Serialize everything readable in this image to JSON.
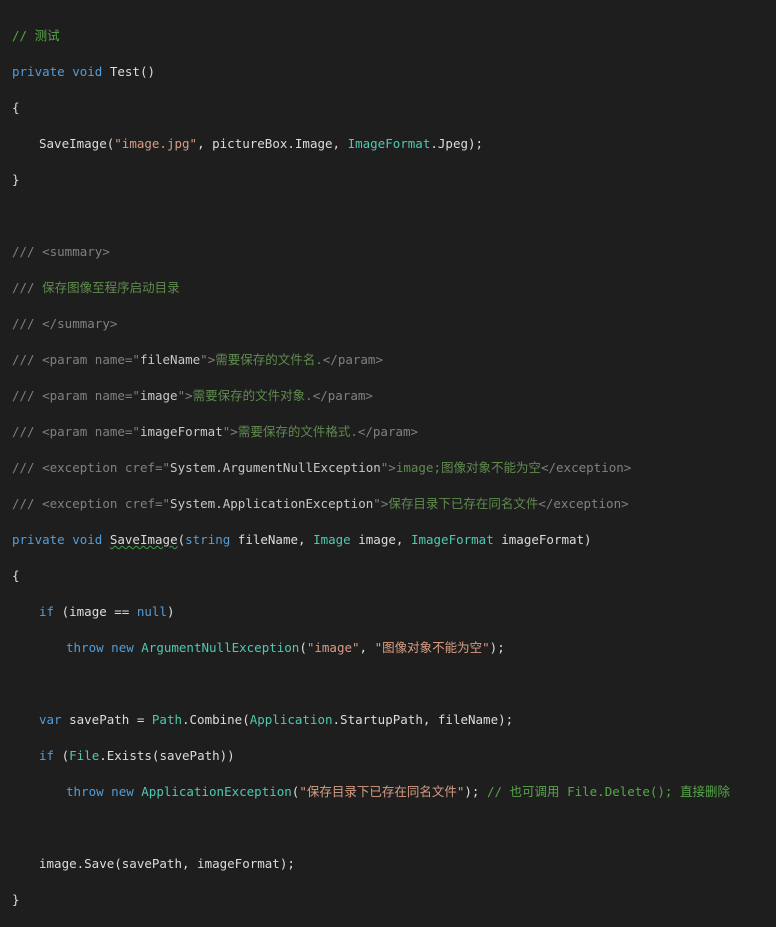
{
  "code": {
    "l1_comment": "// 测试",
    "l2_private": "private",
    "l2_void": "void",
    "l2_name": "Test()",
    "l3_brace": "{",
    "l4_call": "SaveImage(",
    "l4_str": "\"image.jpg\"",
    "l4_mid": ", pictureBox.Image, ",
    "l4_type": "ImageFormat",
    "l4_end": ".Jpeg);",
    "l5_brace": "}",
    "l7_doc": "///",
    "l7_tag": "<summary>",
    "l8_doc": "///",
    "l8_text": "保存图像至程序启动目录",
    "l9_doc": "///",
    "l9_tag": "</summary>",
    "l10_doc": "///",
    "l10_open": "<param name=\"",
    "l10_attr": "fileName",
    "l10_close": "\">",
    "l10_text": "需要保存的文件名.",
    "l10_end": "</param>",
    "l11_doc": "///",
    "l11_open": "<param name=\"",
    "l11_attr": "image",
    "l11_close": "\">",
    "l11_text": "需要保存的文件对象.",
    "l11_end": "</param>",
    "l12_doc": "///",
    "l12_open": "<param name=\"",
    "l12_attr": "imageFormat",
    "l12_close": "\">",
    "l12_text": "需要保存的文件格式.",
    "l12_end": "</param>",
    "l13_doc": "///",
    "l13_open": "<exception cref=\"",
    "l13_attr": "System.ArgumentNullException",
    "l13_close": "\">",
    "l13_text": "image;图像对象不能为空",
    "l13_end": "</exception>",
    "l14_doc": "///",
    "l14_open": "<exception cref=\"",
    "l14_attr": "System.ApplicationException",
    "l14_close": "\">",
    "l14_text": "保存目录下已存在同名文件",
    "l14_end": "</exception>",
    "l15_private": "private",
    "l15_void": "void",
    "l15_name": "SaveImage",
    "l15_p1": "(",
    "l15_string": "string",
    "l15_p2": " fileName, ",
    "l15_image": "Image",
    "l15_p3": " image, ",
    "l15_fmt": "ImageFormat",
    "l15_p4": " imageFormat)",
    "l16_brace": "{",
    "l17_if": "if",
    "l17_a": " (image == ",
    "l17_null": "null",
    "l17_b": ")",
    "l18_throw": "throw",
    "l18_new": "new",
    "l18_type": "ArgumentNullException",
    "l18_a": "(",
    "l18_s1": "\"image\"",
    "l18_b": ", ",
    "l18_s2": "\"图像对象不能为空\"",
    "l18_c": ");",
    "l20_var": "var",
    "l20_a": " savePath = ",
    "l20_path": "Path",
    "l20_b": ".Combine(",
    "l20_app": "Application",
    "l20_c": ".StartupPath, fileName);",
    "l21_if": "if",
    "l21_a": " (",
    "l21_file": "File",
    "l21_b": ".Exists(savePath))",
    "l22_throw": "throw",
    "l22_new": "new",
    "l22_type": "ApplicationException",
    "l22_a": "(",
    "l22_s": "\"保存目录下已存在同名文件\"",
    "l22_b": "); ",
    "l22_cm": "// 也可调用 File.Delete(); 直接删除",
    "l24_a": "image.Save(savePath, imageFormat);",
    "l25_brace": "}"
  }
}
